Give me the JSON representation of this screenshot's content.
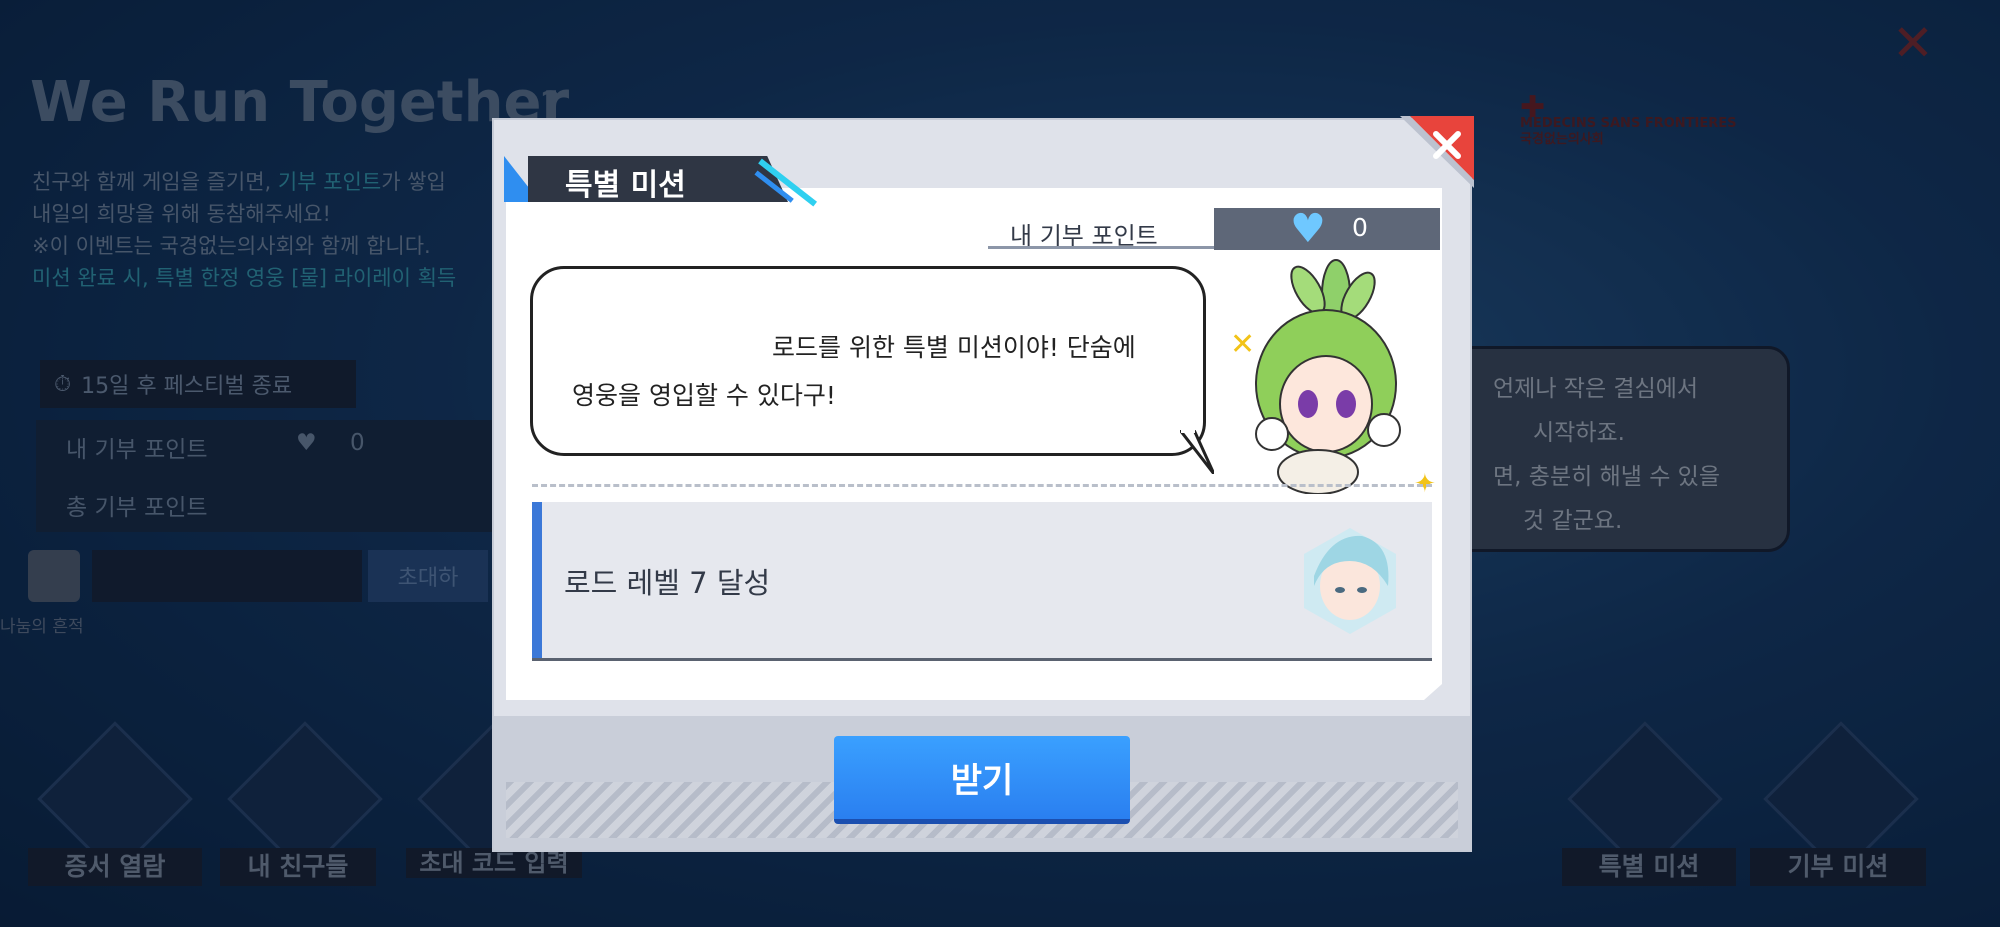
{
  "background": {
    "title": "We Run Together",
    "help_icon": "?",
    "description_lines": [
      {
        "pre": "친구와 함께 게임을 즐기면, ",
        "hl": "기부 포인트",
        "post": "가 쌓입"
      },
      {
        "pre": "내일의 희망을 위해 동참해주세요!",
        "hl": "",
        "post": ""
      },
      {
        "pre": "※이 이벤트는 국경없는의사회와 함께 합니다.",
        "hl": "",
        "post": ""
      },
      {
        "pre": "",
        "hl": "미션 완료 시, 특별 한정 영웅 [물] 라이레이 획득",
        "post": ""
      }
    ],
    "timer": "15일 후 페스티벌 종료",
    "my_points_label": "내 기부 포인트",
    "my_points_value": "0",
    "total_points_label": "총 기부 포인트",
    "invite_button": "초대하",
    "history_label": "나눔의 흔적",
    "side_bubble": [
      "언제나 작은 결심에서",
      "시작하죠.",
      "면, 충분히 해낼 수 있을",
      "것 같군요."
    ],
    "bottom_buttons": [
      "증서 열람",
      "내 친구들",
      "초대 코드 입력",
      "특별 미션",
      "기부 미션"
    ],
    "msf_text": [
      "MEDECINS SANS FRONTIERES",
      "국경없는의사회"
    ],
    "close_icon": "close-icon"
  },
  "dialog": {
    "title": "특별 미션",
    "my_points_label": "내 기부 포인트",
    "my_points_value": "0",
    "speech": [
      "로드를 위한 특별 미션이야! 단숨에",
      "영웅을 영입할 수 있다구!"
    ],
    "mission_text": "로드 레벨 7 달성",
    "receive_button": "받기",
    "accent_color": "#2f8ef0",
    "close_color": "#e8443c"
  }
}
